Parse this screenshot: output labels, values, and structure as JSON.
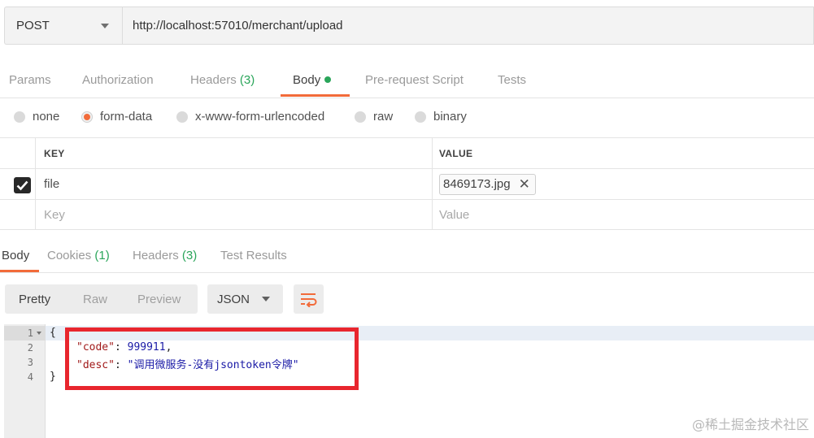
{
  "request": {
    "method": "POST",
    "url": "http://localhost:57010/merchant/upload"
  },
  "request_tabs": {
    "params": "Params",
    "authorization": "Authorization",
    "headers_label": "Headers",
    "headers_count": "(3)",
    "body": "Body",
    "prerequest": "Pre-request Script",
    "tests": "Tests"
  },
  "body_types": {
    "none": "none",
    "form_data": "form-data",
    "urlencoded": "x-www-form-urlencoded",
    "raw": "raw",
    "binary": "binary",
    "selected": "form-data"
  },
  "params_table": {
    "key_header": "KEY",
    "value_header": "VALUE",
    "row_key": "file",
    "row_value": "8469173.jpg",
    "key_placeholder": "Key",
    "value_placeholder": "Value"
  },
  "response_tabs": {
    "body": "Body",
    "cookies_label": "Cookies",
    "cookies_count": "(1)",
    "headers_label": "Headers",
    "headers_count": "(3)",
    "test_results": "Test Results"
  },
  "response_toolbar": {
    "pretty": "Pretty",
    "raw": "Raw",
    "preview": "Preview",
    "format": "JSON"
  },
  "response_code": {
    "line_numbers": [
      "1",
      "2",
      "3",
      "4"
    ],
    "open_brace": "{",
    "close_brace": "}",
    "code_key": "\"code\"",
    "code_value": "999911",
    "desc_key": "\"desc\"",
    "desc_value": "\"调用微服务-没有jsontoken令牌\""
  },
  "watermark": "@稀土掘金技术社区",
  "colors": {
    "accent": "#f26b3a",
    "count_green": "#2aa55a",
    "highlight_red": "#e8262e"
  }
}
